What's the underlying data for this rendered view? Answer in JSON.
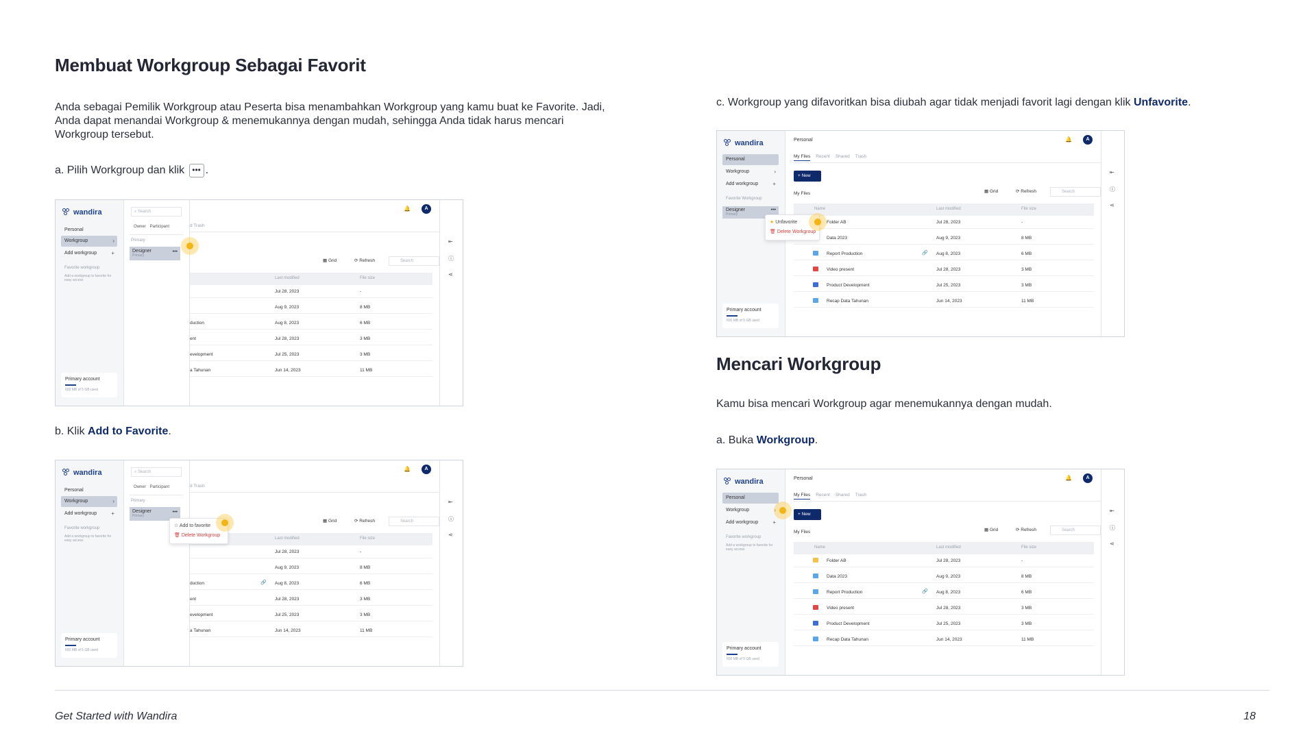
{
  "left": {
    "title": "Membuat Workgroup Sebagai Favorit",
    "intro": "Anda sebagai Pemilik Workgroup  atau Peserta bisa menambahkan Workgroup yang kamu buat ke Favorite. Jadi, Anda dapat menandai Workgroup & menemukannya dengan mudah, sehingga Anda tidak harus mencari Workgroup tersebut.",
    "step_a_prefix": "a. Pilih Workgroup dan klik",
    "step_a_suffix": ".",
    "step_a_icon": "•••",
    "step_b_prefix": "b. Klik",
    "step_b_bold": "Add to Favorite",
    "step_b_suffix": "."
  },
  "right": {
    "step_c_prefix": "c. Workgroup  yang difavoritkan bisa diubah agar tidak menjadi favorit lagi dengan klik",
    "step_c_bold": "Unfavorite",
    "step_c_suffix": ".",
    "title": "Mencari Workgroup",
    "intro": "Kamu bisa mencari Workgroup agar menemukannya dengan mudah.",
    "step_a_prefix": "a. Buka",
    "step_a_bold": "Workgroup",
    "step_a_suffix": "."
  },
  "app": {
    "logo": "wandira",
    "sidebar": {
      "personal": "Personal",
      "workgroup": "Workgroup",
      "add_workgroup": "Add workgroup",
      "favorite_workgroup": "Favorite workgroup",
      "favorite_workgroup_cap": "Favorite Workgroup",
      "favorite_hint": "Add a workgroup to favorite for easy access",
      "fav_item": "Designer",
      "fav_item_sub": "Primary",
      "account": "Primary account",
      "usage": "600 MB of 5 GB used"
    },
    "header_title": "Personal",
    "avatar": "A",
    "tabs": [
      "My Files",
      "Recent",
      "Shared",
      "Trash"
    ],
    "tab_partial": "d  Trash",
    "new_button": "+ New",
    "my_files": "My Files",
    "grid": "Grid",
    "refresh": "Refresh",
    "search": "Search",
    "columns": [
      "Name",
      "Last modified",
      "File size"
    ],
    "files": [
      {
        "name": "Folder AB",
        "partial": "",
        "modified": "Jul 28, 2023",
        "size": "-",
        "type": "folder"
      },
      {
        "name": "Data 2023",
        "partial": "",
        "modified": "Aug 9, 2023",
        "size": "8 MB",
        "type": "doc"
      },
      {
        "name": "Report Production",
        "partial": "duction",
        "modified": "Aug 8, 2023",
        "size": "6 MB",
        "type": "doc"
      },
      {
        "name": "Video present",
        "partial": "ent",
        "modified": "Jul 28, 2023",
        "size": "3 MB",
        "type": "video"
      },
      {
        "name": "Product Development",
        "partial": "evelopment",
        "modified": "Jul 25, 2023",
        "size": "3 MB",
        "type": "slides"
      },
      {
        "name": "Recap Data Tahunan",
        "partial": "a Tahunan",
        "modified": "Jun 14, 2023",
        "size": "11 MB",
        "type": "doc"
      }
    ],
    "overlay": {
      "search": "Search",
      "owner": "Owner",
      "participant": "Participant",
      "primary": "Primary",
      "item": "Designer",
      "item_sub": "Primary"
    },
    "menu": {
      "add_to_favorite": "Add to favorite",
      "unfavorite": "Unfavorite",
      "delete_workgroup": "Delete Workgroup"
    }
  },
  "footer": {
    "left": "Get Started with Wandira",
    "page": "18"
  },
  "colors": {
    "brand_navy": "#0e2a6b",
    "highlight": "#f2b515",
    "danger": "#d63b3b"
  }
}
